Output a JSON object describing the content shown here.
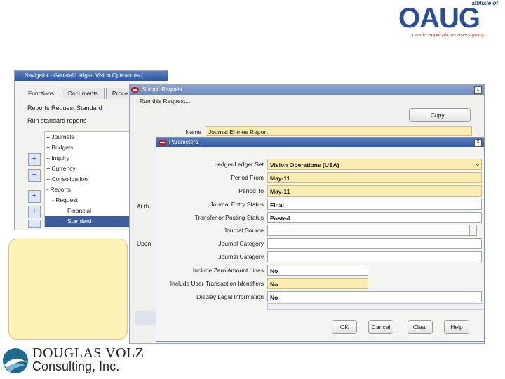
{
  "logo": {
    "affiliate": "affiliate of",
    "name": "OAUG",
    "tagline": "oracle applications users group"
  },
  "navigator": {
    "title": "Navigator - General Ledger, Vision Operations (",
    "tabs": [
      "Functions",
      "Documents",
      "Proce"
    ],
    "heading": "Reports Request Standard",
    "subheading": "Run standard reports",
    "tree": [
      "+ Journals",
      "+ Budgets",
      "+ Inquiry",
      "+ Currency",
      "+ Consolidation",
      "- Reports",
      "- Request",
      "Financial",
      "Standard"
    ],
    "buttons": [
      "+",
      "−",
      "+",
      "+",
      "−"
    ]
  },
  "submit_request": {
    "title": "Submit Request",
    "section": "Run this Request...",
    "copy_button": "Copy...",
    "name_label": "Name",
    "name_value": "Journal Entries Report",
    "left_labels": [
      "At th",
      "Upon"
    ]
  },
  "parameters": {
    "title": "Parameters",
    "fields": [
      {
        "label": "Ledger/Ledger Set",
        "value": "Vision Operations (USA)",
        "required": true
      },
      {
        "label": "Period From",
        "value": "May-11",
        "required": true
      },
      {
        "label": "Period To",
        "value": "May-11",
        "required": true
      },
      {
        "label": "Journal Entry Status",
        "value": "Final",
        "required": false
      },
      {
        "label": "Transfer or Posting Status",
        "value": "Posted",
        "required": false
      },
      {
        "label": "Journal Source",
        "value": "",
        "required": false
      },
      {
        "label": "Journal Category",
        "value": "",
        "required": false
      },
      {
        "label": "Journal Category",
        "value": "",
        "required": false
      },
      {
        "label": "Include Zero Amount Lines",
        "value": "No",
        "required": false
      },
      {
        "label": "Include User Transaction Identifiers",
        "value": "No",
        "required": true
      },
      {
        "label": "Display Legal Information",
        "value": "No",
        "required": false
      }
    ],
    "buttons": [
      "OK",
      "Cancel",
      "Clear",
      "Help"
    ]
  },
  "footer_logo": {
    "name": "DOUGLAS VOLZ",
    "subtitle": "Consulting, Inc."
  }
}
